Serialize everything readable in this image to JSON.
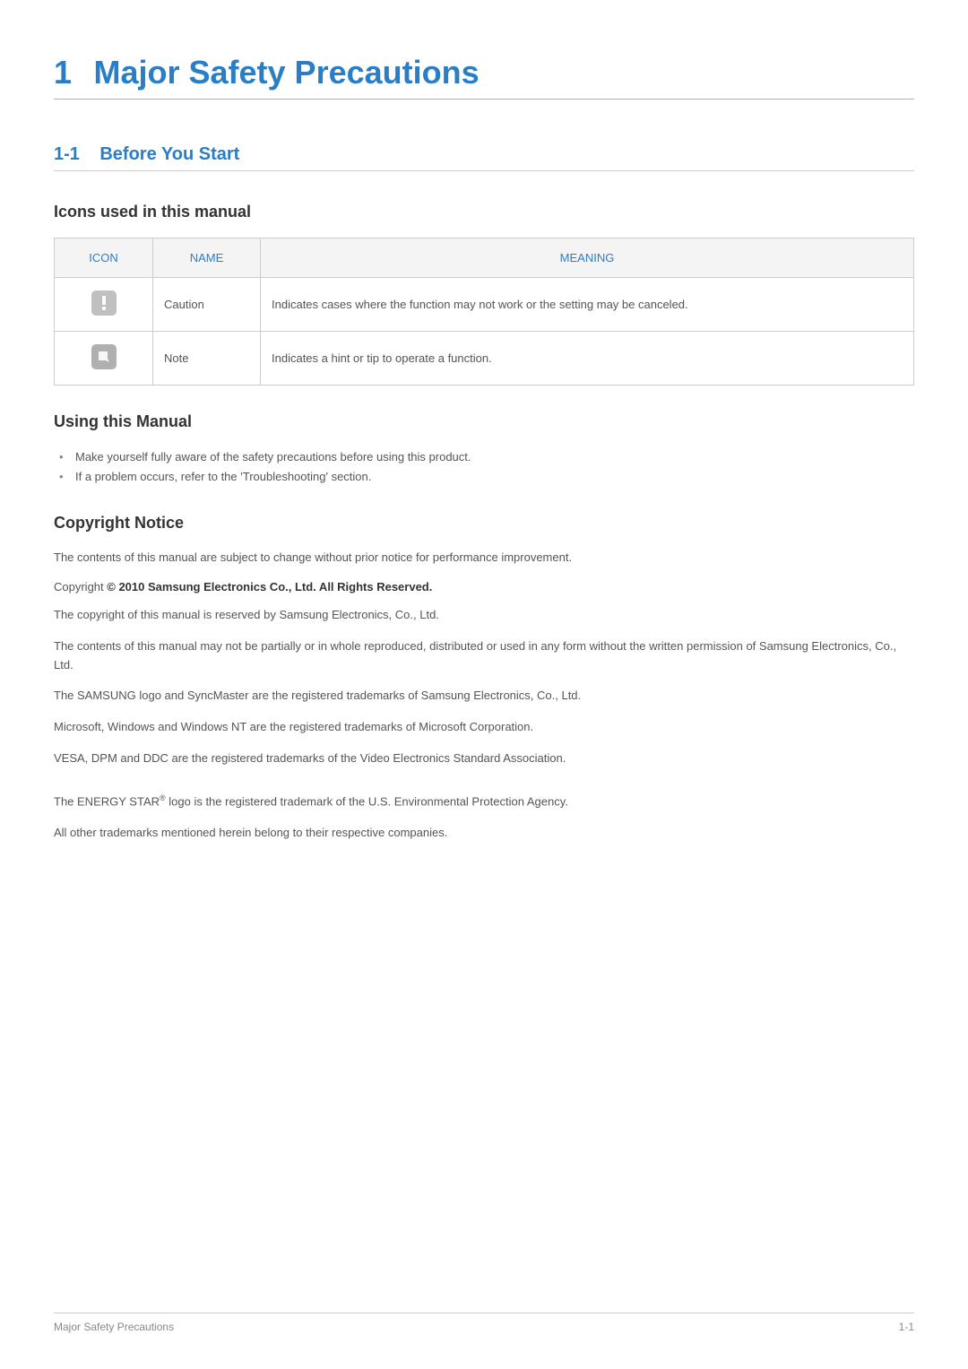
{
  "chapter": {
    "number": "1",
    "title": "Major Safety Precautions"
  },
  "section": {
    "number": "1-1",
    "title": "Before You Start"
  },
  "icons_heading": "Icons used in this manual",
  "table": {
    "headers": {
      "icon": "ICON",
      "name": "NAME",
      "meaning": "MEANING"
    },
    "rows": [
      {
        "name": "Caution",
        "meaning": "Indicates cases where the function may not work or the setting may be canceled."
      },
      {
        "name": "Note",
        "meaning": "Indicates a hint or tip to operate a function."
      }
    ]
  },
  "using_heading": "Using this Manual",
  "using_bullets": [
    "Make yourself fully aware of the safety precautions before using this product.",
    "If a problem occurs, refer to the 'Troubleshooting' section."
  ],
  "copyright_heading": "Copyright Notice",
  "copyright_intro": "The contents of this manual are subject to change without prior notice for performance improvement.",
  "copyright_line_prefix": "Copyright ",
  "copyright_symbol": "©",
  "copyright_line_bold": "  2010 Samsung Electronics Co., Ltd. All Rights Reserved.",
  "paragraphs": {
    "p1": "The copyright of this manual is reserved by Samsung Electronics, Co., Ltd.",
    "p2": "The contents of this manual may not be partially or in whole reproduced, distributed or used in any form without the written permission of Samsung Electronics, Co., Ltd.",
    "p3": "The SAMSUNG logo and SyncMaster are the registered trademarks of Samsung Electronics, Co., Ltd.",
    "p4": "Microsoft, Windows and Windows NT are the registered trademarks of Microsoft Corporation.",
    "p5": "VESA, DPM and DDC are the registered trademarks of the Video Electronics Standard Association.",
    "p6_pre": "The ENERGY STAR",
    "p6_sup": "®",
    "p6_post": " logo is the registered trademark of the U.S. Environmental Protection Agency.",
    "p7": "All other trademarks mentioned herein belong to their respective companies."
  },
  "footer": {
    "left": "Major Safety Precautions",
    "right": "1-1"
  }
}
